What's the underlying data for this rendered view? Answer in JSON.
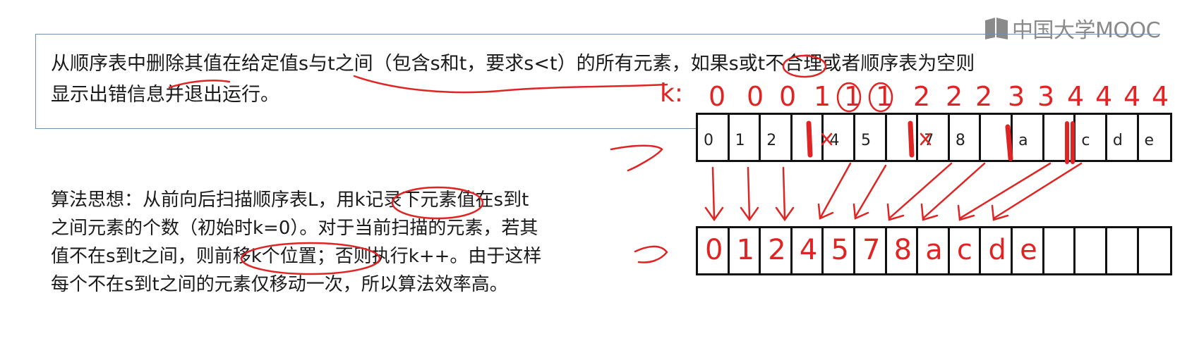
{
  "logo": {
    "text": "中国大学MOOC",
    "icon": "book-icon"
  },
  "problem": {
    "line1": "从顺序表中删除其值在给定值s与t之间（包含s和t，要求s<t）的所有元素，如果s或t不合理或者顺序表为空则",
    "line2": "显示出错信息并退出运行。"
  },
  "algorithm": {
    "lines": [
      "算法思想：从前向后扫描顺序表L，用k记录下元素值在s到t",
      "之间元素的个数（初始时k=0）。对于当前扫描的元素，若其",
      "值不在s到t之间，则前移k个位置；否则执行k++。由于这样",
      "每个不在s到t之间的元素仅移动一次，所以算法效率高。"
    ]
  },
  "k_row": {
    "label": "k:",
    "values": [
      "0",
      "0",
      "0",
      "1",
      "1",
      "1",
      "2",
      "2",
      "2",
      "3",
      "3",
      "4",
      "4",
      "4",
      "4"
    ]
  },
  "array_top": {
    "cells": [
      "0",
      "1",
      "2",
      "",
      "4",
      "5",
      "",
      "7",
      "8",
      "",
      "a",
      "",
      "c",
      "d",
      "e"
    ]
  },
  "array_bottom": {
    "cells": [
      "0",
      "1",
      "2",
      "4",
      "5",
      "7",
      "8",
      "a",
      "c",
      "d",
      "e",
      "",
      "",
      "",
      ""
    ]
  },
  "colors": {
    "annotation": "#e02424",
    "box_border": "#6f8fb3",
    "text": "#1a1a1a"
  }
}
